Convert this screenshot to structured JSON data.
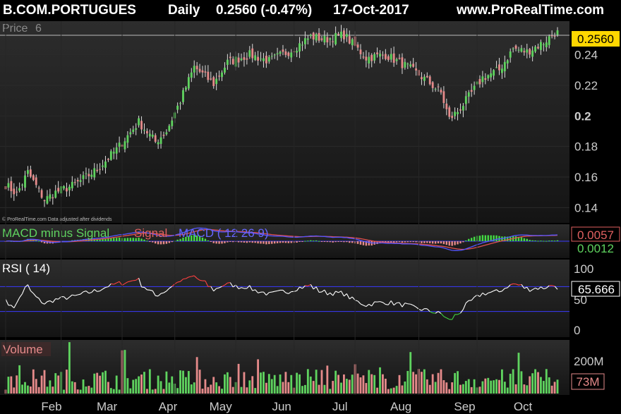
{
  "header": {
    "instrument": "B.COM.PORTUGUES",
    "period": "Daily",
    "quote": "0.2560 (-0.47%)",
    "date": "17-Oct-2017",
    "site": "www.ProRealTime.com"
  },
  "colors": {
    "up": "#5fd35f",
    "down": "#e58a8a",
    "macd": "#5555ff",
    "signal": "#e05050",
    "histogram": "#44dd44",
    "rsi": "#ffffff",
    "rsi_overbought": "#ff4040",
    "rsi_oversold": "#40d040",
    "price_tag_bg": "#ffd700",
    "grid": "#2a2a2a"
  },
  "price_panel": {
    "title": "Price",
    "title_suffix": "6",
    "copyright": "© ProRealTime.com  Data adjusted after dividends",
    "last_value_tag": "0.2560",
    "y_ticks": [
      "0.24",
      "0.22",
      "0.2",
      "0.18",
      "0.16",
      "0.14"
    ]
  },
  "macd_panel": {
    "title_hist": "MACD minus Signal",
    "title_signal": "Signal",
    "title_macd": "MACD ( 12 26 9)",
    "value_top": "0.0057",
    "value_bottom": "0.0012"
  },
  "rsi_panel": {
    "title": "RSI ( 14)",
    "y_ticks": [
      "100",
      "50",
      "0"
    ],
    "value": "65.666",
    "upper_level": 70,
    "lower_level": 30
  },
  "volume_panel": {
    "title": "Volume",
    "y_tick": "200M",
    "value": "73M"
  },
  "x_axis": {
    "months": [
      "Feb",
      "Mar",
      "Apr",
      "May",
      "Jun",
      "Jul",
      "Aug",
      "Sep",
      "Oct"
    ]
  },
  "chart_data": {
    "type": "candlestick",
    "title": "B.COM.PORTUGUES",
    "ylim": [
      0.13,
      0.262
    ],
    "month_start_index": [
      0,
      20,
      42,
      61,
      83,
      104,
      126,
      149,
      170
    ],
    "close_anchors": [
      [
        0,
        0.155
      ],
      [
        4,
        0.149
      ],
      [
        8,
        0.163
      ],
      [
        14,
        0.145
      ],
      [
        18,
        0.15
      ],
      [
        25,
        0.155
      ],
      [
        33,
        0.165
      ],
      [
        40,
        0.178
      ],
      [
        48,
        0.196
      ],
      [
        54,
        0.183
      ],
      [
        58,
        0.19
      ],
      [
        63,
        0.21
      ],
      [
        68,
        0.232
      ],
      [
        75,
        0.221
      ],
      [
        80,
        0.235
      ],
      [
        88,
        0.24
      ],
      [
        95,
        0.236
      ],
      [
        103,
        0.243
      ],
      [
        110,
        0.252
      ],
      [
        115,
        0.25
      ],
      [
        122,
        0.253
      ],
      [
        130,
        0.238
      ],
      [
        137,
        0.24
      ],
      [
        145,
        0.232
      ],
      [
        152,
        0.223
      ],
      [
        157,
        0.215
      ],
      [
        160,
        0.198
      ],
      [
        163,
        0.203
      ],
      [
        166,
        0.21
      ],
      [
        172,
        0.225
      ],
      [
        178,
        0.23
      ],
      [
        183,
        0.244
      ],
      [
        188,
        0.242
      ],
      [
        194,
        0.248
      ],
      [
        199,
        0.256
      ]
    ],
    "macd": {
      "series": [
        {
          "name": "MACD minus Signal",
          "role": "histogram"
        },
        {
          "name": "Signal",
          "role": "line"
        },
        {
          "name": "MACD ( 12 26 9)",
          "role": "line"
        }
      ],
      "last_macd": 0.0057,
      "last_histogram": 0.0012
    },
    "rsi": {
      "period": 14,
      "last": 65.666,
      "ylim": [
        0,
        100
      ]
    },
    "volume": {
      "last": "73M",
      "ytick": "200M"
    }
  }
}
